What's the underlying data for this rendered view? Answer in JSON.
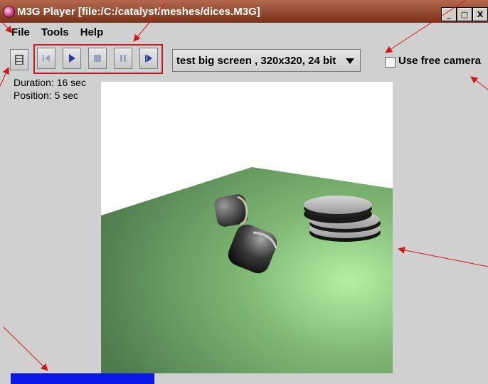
{
  "title": "M3G Player  [file:/C:/catalyst/meshes/dices.M3G]",
  "window_buttons": [
    "_",
    "□",
    "X"
  ],
  "menu": {
    "file": "File",
    "tools": "Tools",
    "help": "Help"
  },
  "combo": {
    "value": "test big screen , 320x320, 24 bit"
  },
  "free_camera": {
    "label": "Use free camera",
    "checked": false
  },
  "info": {
    "duration": "Duration: 16 sec",
    "position": "Position: 5 sec"
  },
  "progress": {
    "fraction": 0.31
  },
  "colors": {
    "titlebar": "#8a3e22",
    "annotation": "#d01818",
    "progress": "#0a18e8",
    "floor": "#6fa66a"
  },
  "icons": [
    "film-icon",
    "rewind-icon",
    "play-icon",
    "stop-icon",
    "pause-icon",
    "step-forward-icon"
  ]
}
